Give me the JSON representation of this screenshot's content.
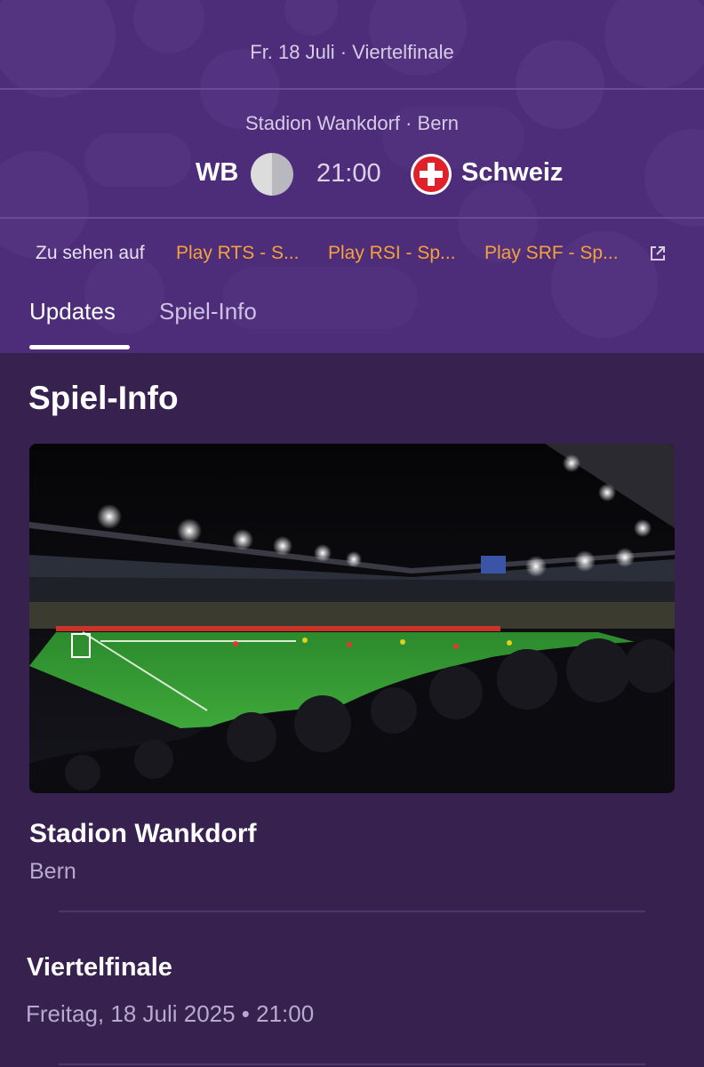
{
  "match": {
    "date_round": "Fr. 18 Juli · Viertelfinale",
    "venue": "Stadion Wankdorf · Bern",
    "home_team": "WB",
    "kickoff": "21:00",
    "away_team": "Schweiz"
  },
  "broadcast": {
    "label": "Zu sehen auf",
    "channels": [
      "Play RTS - S...",
      "Play RSI - Sp...",
      "Play SRF - Sp..."
    ],
    "link_color": "#f6a23a"
  },
  "tabs": [
    "Updates",
    "Spiel-Info"
  ],
  "active_tab": 0,
  "info": {
    "section_title": "Spiel-Info",
    "stadium_name": "Stadion Wankdorf",
    "stadium_city": "Bern",
    "round_title": "Viertelfinale",
    "round_date": "Freitag, 18 Juli 2025 • 21:00"
  },
  "icons": {
    "home_badge": "team-badge-icon",
    "away_badge": "swiss-flag-icon",
    "external": "external-link-icon"
  },
  "colors": {
    "header_bg": "#4d2c7a",
    "page_bg": "#37214e",
    "accent": "#f6a23a"
  }
}
